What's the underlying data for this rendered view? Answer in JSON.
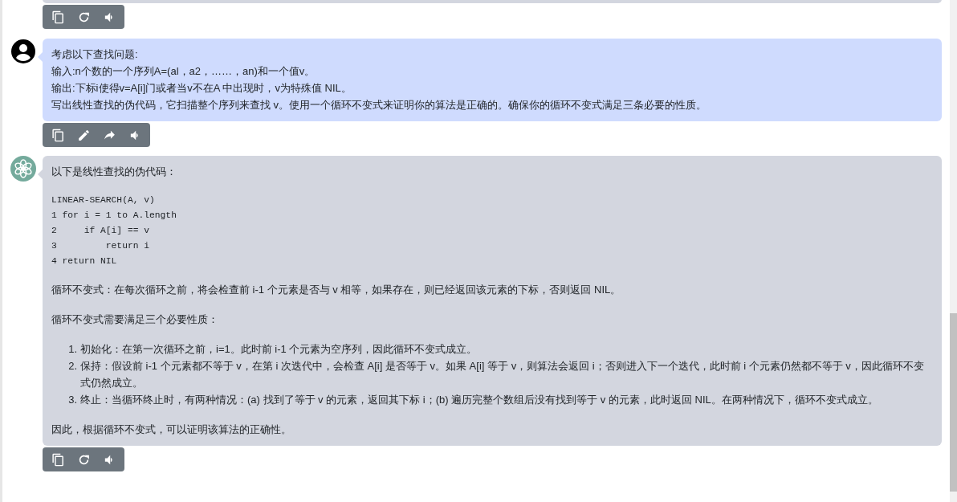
{
  "messages": [
    {
      "kind": "partial",
      "actions": [
        {
          "kind": "copy"
        },
        {
          "kind": "regenerate"
        },
        {
          "kind": "speak"
        }
      ]
    },
    {
      "kind": "user",
      "blocks": [
        {
          "kind": "lines",
          "lines": [
            "考虑以下查找问题:",
            "输入:n个数的一个序列A=(al，a2，……，an)和一个值v。",
            "输出:下标i使得v=A[i]门或者当v不在A 中出现时，v为特殊值 NIL。",
            "写出线性查找的伪代码，它扫描整个序列来查找 v。使用一个循环不变式来证明你的算法是正确的。确保你的循环不变式满足三条必要的性质。"
          ]
        }
      ],
      "actions": [
        {
          "kind": "copy"
        },
        {
          "kind": "edit"
        },
        {
          "kind": "share"
        },
        {
          "kind": "speak"
        }
      ]
    },
    {
      "kind": "assistant",
      "blocks": [
        {
          "kind": "paragraph",
          "text": "以下是线性查找的伪代码："
        },
        {
          "kind": "code",
          "lines": [
            "LINEAR-SEARCH(A, v)",
            "1 for i = 1 to A.length",
            "2     if A[i] == v",
            "3         return i",
            "4 return NIL"
          ]
        },
        {
          "kind": "paragraph",
          "text": "循环不变式：在每次循环之前，将会检查前 i-1 个元素是否与 v 相等，如果存在，则已经返回该元素的下标，否则返回 NIL。"
        },
        {
          "kind": "paragraph",
          "text": "循环不变式需要满足三个必要性质："
        },
        {
          "kind": "ordered_list",
          "items": [
            {
              "number": "1.",
              "text": "初始化：在第一次循环之前，i=1。此时前 i-1 个元素为空序列，因此循环不变式成立。"
            },
            {
              "number": "2.",
              "text": "保持：假设前 i-1 个元素都不等于 v，在第 i 次迭代中，会检查 A[i] 是否等于 v。如果 A[i] 等于 v，则算法会返回 i；否则进入下一个迭代，此时前 i 个元素仍然都不等于 v，因此循环不变式仍然成立。"
            },
            {
              "number": "3.",
              "text": "终止：当循环终止时，有两种情况：(a) 找到了等于 v 的元素，返回其下标 i；(b) 遍历完整个数组后没有找到等于 v 的元素，此时返回 NIL。在两种情况下，循环不变式成立。"
            }
          ]
        },
        {
          "kind": "paragraph",
          "text": "因此，根据循环不变式，可以证明该算法的正确性。"
        }
      ],
      "actions": [
        {
          "kind": "copy"
        },
        {
          "kind": "regenerate"
        },
        {
          "kind": "speak"
        }
      ]
    }
  ]
}
